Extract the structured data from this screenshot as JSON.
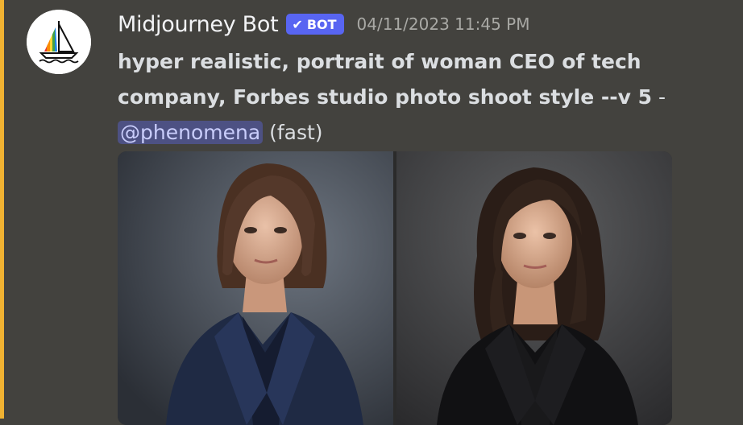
{
  "message": {
    "author": "Midjourney Bot",
    "bot_tag": "BOT",
    "timestamp": "04/11/2023 11:45 PM",
    "prompt": "hyper realistic, portrait of woman CEO of tech company, Forbes studio photo shoot style --v 5",
    "separator": " - ",
    "mention": "@phenomena",
    "speed": "(fast)"
  },
  "icons": {
    "avatar": "sailboat-logo-icon",
    "verified": "checkmark-icon"
  },
  "colors": {
    "background": "#43423e",
    "highlight": "#f0b232",
    "bot_tag": "#5865f2",
    "mention_bg": "#4d5183",
    "mention_text": "#c9cdfb"
  },
  "attachment": {
    "images": [
      "portrait-woman-short-hair",
      "portrait-woman-long-hair"
    ]
  }
}
